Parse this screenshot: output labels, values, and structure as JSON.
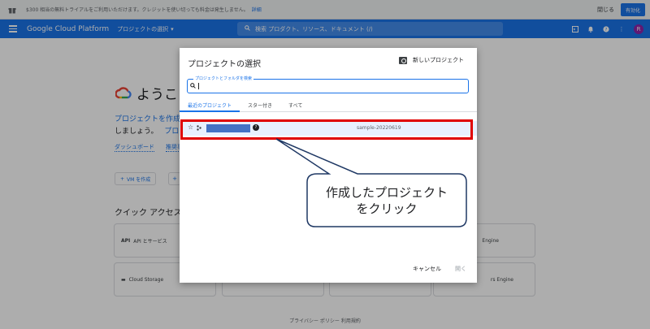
{
  "promo": {
    "text": "$300 相当の無料トライアルをご利用いただけます。クレジットを使い切っても料金は発生しません。",
    "link": "詳細",
    "dismiss": "閉じる",
    "activate": "有効化"
  },
  "topbar": {
    "brand": "Google Cloud Platform",
    "project_select": "プロジェクトの選択",
    "search_placeholder": "検索 プロダクト、リソース、ドキュメント (/)",
    "avatar_letter": "R"
  },
  "background": {
    "welcome": "ようこ",
    "intro_line1": "プロジェクトを作成",
    "intro_line2": "しましょう。",
    "intro_project": "プロ",
    "link1": "ダッシュボード",
    "link2": "推奨事項",
    "vm_button": "VM を作成",
    "quick_access": "クイック アクセス",
    "cards": [
      {
        "label": "API とサービス",
        "icon": "API"
      },
      {
        "label": "Cloud Storage",
        "icon": "▬"
      },
      {
        "label": "Engine",
        "icon": ""
      },
      {
        "label": "rs Engine",
        "icon": ""
      }
    ],
    "footer": "プライバシー ポリシー 利用規約"
  },
  "modal": {
    "title": "プロジェクトの選択",
    "new_project": "新しいプロジェクト",
    "search_label": "プロジェクトとフォルダを検索",
    "tabs": [
      {
        "label": "最近のプロジェクト",
        "active": true
      },
      {
        "label": "スター付き",
        "active": false
      },
      {
        "label": "すべて",
        "active": false
      }
    ],
    "row": {
      "project_id": "sample-20220619"
    },
    "cancel": "キャンセル",
    "open": "開く"
  },
  "annotation": {
    "line1": "作成したプロジェクト",
    "line2": "をクリック",
    "highlight_color": "#e00000",
    "callout_border": "#1f3864"
  },
  "colors": {
    "accent": "#1a73e8",
    "redacted": "#4472c4"
  }
}
